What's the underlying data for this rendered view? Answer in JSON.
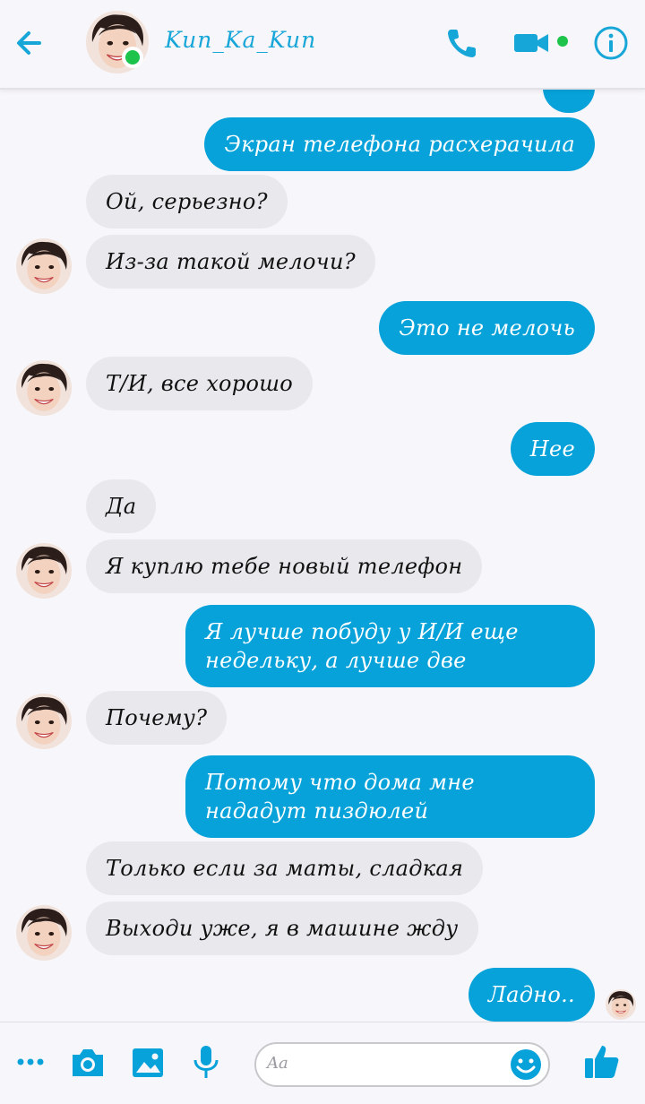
{
  "header": {
    "contact_name": "Kun_Ka_Kun"
  },
  "messages": [
    {
      "direction": "out",
      "text": "Экран телефона расхерачила"
    },
    {
      "direction": "in",
      "text": "Ой, серьезно?"
    },
    {
      "direction": "in",
      "text": "Из-за такой мелочи?"
    },
    {
      "direction": "out",
      "text": "Это не мелочь"
    },
    {
      "direction": "in",
      "text": "Т/И, все хорошо"
    },
    {
      "direction": "out",
      "text": "Нее"
    },
    {
      "direction": "in",
      "text": "Да"
    },
    {
      "direction": "in",
      "text": "Я куплю тебе новый телефон"
    },
    {
      "direction": "out",
      "text": "Я лучше побуду у И/И еще недельку, а лучше две"
    },
    {
      "direction": "in",
      "text": "Почему?"
    },
    {
      "direction": "out",
      "text": "Потому что дома мне нададут пиздюлей"
    },
    {
      "direction": "in",
      "text": "Только если за маты, сладкая"
    },
    {
      "direction": "in",
      "text": "Выходи уже, я в машине жду"
    },
    {
      "direction": "out",
      "text": "Ладно.."
    }
  ],
  "composer": {
    "placeholder": "Aa"
  },
  "icons": {
    "back": "arrow-left-icon",
    "call": "phone-icon",
    "video": "video-camera-icon",
    "info": "info-icon",
    "more": "more-dots-icon",
    "camera": "camera-icon",
    "gallery": "image-icon",
    "voice": "microphone-icon",
    "emoji": "smiley-icon",
    "like": "thumbs-up-icon"
  },
  "colors": {
    "accent": "#17a6d8",
    "outgoing_bubble": "#06a2d9",
    "incoming_bubble": "#e9e8ec",
    "online": "#1dc34b"
  }
}
